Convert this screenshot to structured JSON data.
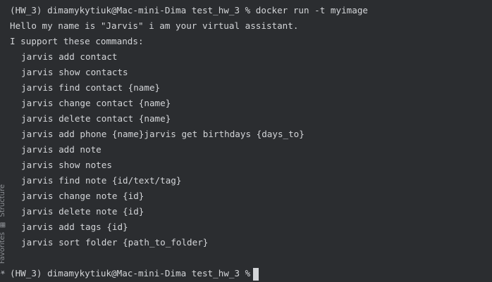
{
  "terminal": {
    "lines": [
      "(HW_3) dimamykytiuk@Mac-mini-Dima test_hw_3 % docker run -t myimage",
      "Hello my name is \"Jarvis\" i am your virtual assistant.",
      "I support these commands:",
      "jarvis add contact",
      "jarvis show contacts",
      "jarvis find contact {name}",
      "jarvis change contact {name}",
      "jarvis delete contact {name}",
      "jarvis add phone {name}jarvis get birthdays {days_to}",
      "jarvis add note",
      "jarvis show notes",
      "jarvis find note {id/text/tag}",
      "jarvis change note {id}",
      "jarvis delete note {id}",
      "jarvis add tags {id}",
      "jarvis sort folder {path_to_folder}"
    ],
    "prompt": "(HW_3) dimamykytiuk@Mac-mini-Dima test_hw_3 %"
  },
  "side_tabs": {
    "structure": "Structure",
    "favorites": "Favorites"
  },
  "icons": {
    "structure": "structure-icon",
    "favorites": "star-icon"
  },
  "colors": {
    "background": "#2b2d30",
    "text": "#d3d5d8",
    "muted": "#8c8f94"
  }
}
